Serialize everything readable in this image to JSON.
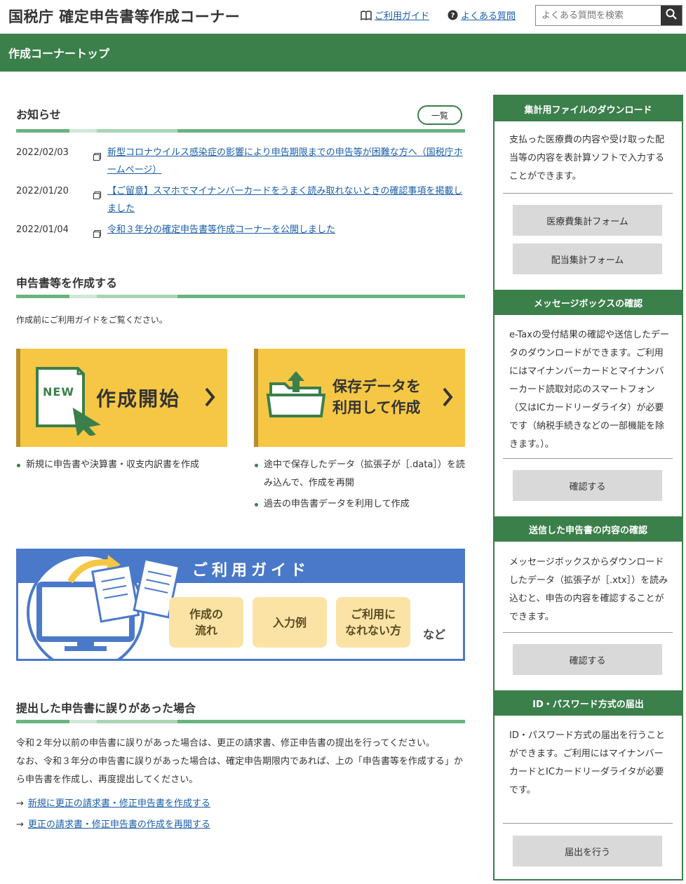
{
  "header": {
    "title": "国税庁 確定申告書等作成コーナー",
    "guide_link": "ご利用ガイド",
    "faq_link": "よくある質問",
    "search_placeholder": "よくある質問を検索"
  },
  "nav": {
    "title": "作成コーナートップ"
  },
  "news": {
    "title": "お知らせ",
    "all_button": "一覧",
    "items": [
      {
        "date": "2022/02/03",
        "text": "新型コロナウイルス感染症の影響により申告期限までの申告等が困難な方へ（国税庁ホームページ）"
      },
      {
        "date": "2022/01/20",
        "text": "【ご留意】スマホでマイナンバーカードをうまく読み取れないときの確認事項を掲載しました"
      },
      {
        "date": "2022/01/04",
        "text": "令和３年分の確定申告書等作成コーナーを公開しました"
      }
    ]
  },
  "create": {
    "title": "申告書等を作成する",
    "note": "作成前にご利用ガイドをご覧ください。",
    "start_tile": {
      "badge": "NEW",
      "label": "作成開始"
    },
    "saved_tile": {
      "line1": "保存データを",
      "line2": "利用して作成"
    },
    "start_bullets": [
      "新規に申告書や決算書・収支内訳書を作成"
    ],
    "saved_bullets": [
      "途中で保存したデータ（拡張子が［.data］）を読み込んで、作成を再開",
      "過去の申告書データを利用して作成"
    ]
  },
  "guide": {
    "title": "ご利用ガイド",
    "pill1_l1": "作成の",
    "pill1_l2": "流れ",
    "pill2": "入力例",
    "pill3_l1": "ご利用に",
    "pill3_l2": "なれない方",
    "etc": "など"
  },
  "correction": {
    "title": "提出した申告書に誤りがあった場合",
    "para1": "令和２年分以前の申告書に誤りがあった場合は、更正の請求書、修正申告書の提出を行ってください。",
    "para2": "なお、令和３年分の申告書に誤りがあった場合は、確定申告期限内であれば、上の「申告書等を作成する」から申告書を作成し、再度提出してください。",
    "link1": "新規に更正の請求書・修正申告書を作成する",
    "link2": "更正の請求書・修正申告書の作成を再開する"
  },
  "sidebar": {
    "download": {
      "title": "集計用ファイルのダウンロード",
      "text": "支払った医療費の内容や受け取った配当等の内容を表計算ソフトで入力することができます。",
      "btn1": "医療費集計フォーム",
      "btn2": "配当集計フォーム"
    },
    "message": {
      "title": "メッセージボックスの確認",
      "text": "e-Taxの受付結果の確認や送信したデータのダウンロードができます。ご利用にはマイナンバーカードとマイナンバーカード読取対応のスマートフォン（又はICカードリーダライタ）が必要です（納税手続きなどの一部機能を除きます。）。",
      "btn": "確認する"
    },
    "sent": {
      "title": "送信した申告書の内容の確認",
      "text": "メッセージボックスからダウンロードしたデータ（拡張子が［.xtx］）を読み込むと、申告の内容を確認することができます。",
      "btn": "確認する"
    },
    "idpw": {
      "title": "ID・パスワード方式の届出",
      "text": "ID・パスワード方式の届出を行うことができます。ご利用にはマイナンバーカードとICカードリーダライタが必要です。",
      "btn": "届出を行う"
    }
  }
}
